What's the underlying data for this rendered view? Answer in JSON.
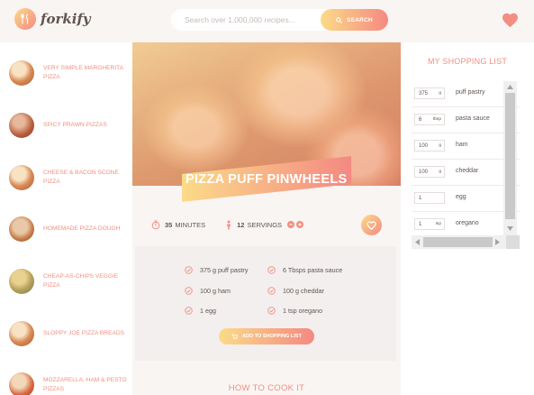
{
  "header": {
    "logo": "forkify",
    "search_placeholder": "Search over 1,000,000 recipes...",
    "search_button": "SEARCH",
    "likes_icon": "heart-icon"
  },
  "results": [
    {
      "name": "Very Simple Margherita Pizza"
    },
    {
      "name": "Spicy Prawn Pizzas"
    },
    {
      "name": "Cheese & Bacon Scone Pizza"
    },
    {
      "name": "Homemade Pizza Dough"
    },
    {
      "name": "Cheap-As-Chips Veggie Pizza"
    },
    {
      "name": "Sloppy Joe Pizza Breads"
    },
    {
      "name": "Mozzarella, Ham & Pesto Pizzas"
    }
  ],
  "recipe": {
    "title": "Pizza Puff Pinwheels",
    "minutes": "35",
    "minutes_label": "MINUTES",
    "servings": "12",
    "servings_label": "SERVINGS",
    "ingredients": [
      "375 g puff pastry",
      "6 Tbsps pasta sauce",
      "100 g ham",
      "100 g cheddar",
      "1 egg",
      "1 tsp oregano"
    ],
    "add_button": "ADD TO SHOPPING LIST",
    "how_title": "How to cook it"
  },
  "shopping": {
    "title": "My Shopping List",
    "items": [
      {
        "qty": "375",
        "unit": "g",
        "desc": "puff pastry"
      },
      {
        "qty": "6",
        "unit": "tbsp",
        "desc": "pasta sauce"
      },
      {
        "qty": "100",
        "unit": "g",
        "desc": "ham"
      },
      {
        "qty": "100",
        "unit": "g",
        "desc": "cheddar"
      },
      {
        "qty": "1",
        "unit": "",
        "desc": "egg"
      },
      {
        "qty": "1",
        "unit": "tsp",
        "desc": "oregano"
      }
    ]
  },
  "colors": {
    "accent_start": "#fbdb89",
    "accent_end": "#f48982",
    "accent_text": "#f38e82",
    "text": "#615551",
    "background": "#f9f5f3"
  }
}
